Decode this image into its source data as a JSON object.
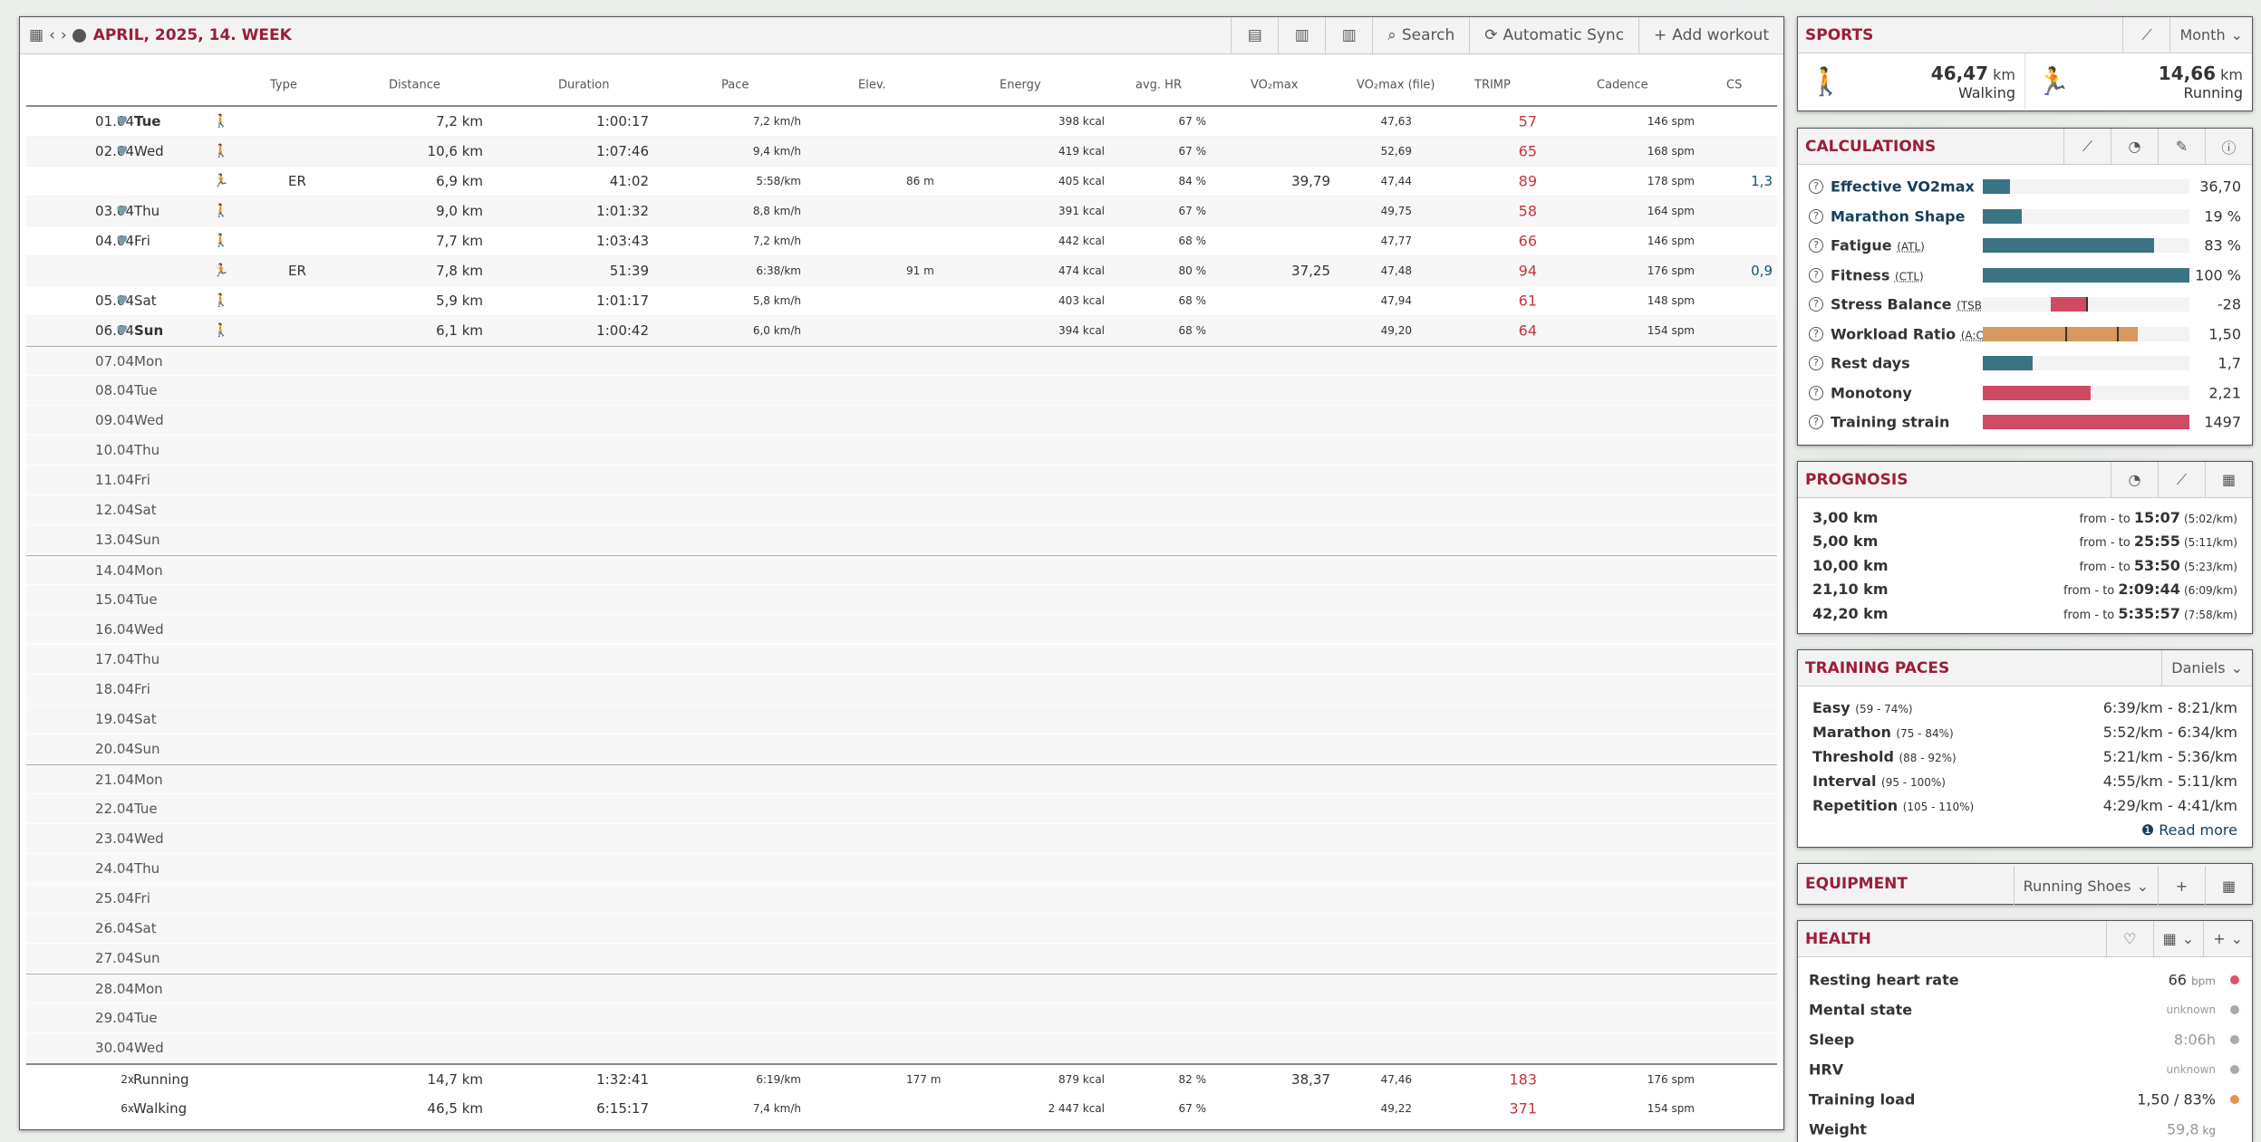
{
  "main": {
    "title": "APRIL, 2025, 14. WEEK",
    "toolbar": {
      "search": "Search",
      "sync": "Automatic Sync",
      "add": "Add workout"
    },
    "columns": {
      "type": "Type",
      "distance": "Distance",
      "duration": "Duration",
      "pace": "Pace",
      "elev": "Elev.",
      "energy": "Energy",
      "hr": "avg. HR",
      "vo2": "VO₂max",
      "vo2file": "VO₂max (file)",
      "trimp": "TRIMP",
      "cadence": "Cadence",
      "cs": "CS"
    },
    "rows": [
      {
        "date": "01.04",
        "day": "Tue",
        "bold": true,
        "icon": "walk",
        "type": "",
        "dist": "7,2 km",
        "dur": "1:00:17",
        "pace": "7,2 km/h",
        "elev": "",
        "energy": "398 kcal",
        "hr": "67 %",
        "vo2": "",
        "vo2f": "47,63",
        "trimp": "57",
        "cad": "146 spm",
        "cs": ""
      },
      {
        "date": "02.04",
        "day": "Wed",
        "bold": false,
        "icon": "walk",
        "type": "",
        "dist": "10,6 km",
        "dur": "1:07:46",
        "pace": "9,4 km/h",
        "elev": "",
        "energy": "419 kcal",
        "hr": "67 %",
        "vo2": "",
        "vo2f": "52,69",
        "trimp": "65",
        "cad": "168 spm",
        "cs": ""
      },
      {
        "date": "",
        "day": "",
        "bold": false,
        "icon": "run",
        "type": "ER",
        "dist": "6,9 km",
        "dur": "41:02",
        "pace": "5:58/km",
        "elev": "86 m",
        "energy": "405 kcal",
        "hr": "84 %",
        "vo2": "39,79",
        "vo2f": "47,44",
        "trimp": "89",
        "cad": "178 spm",
        "cs": "1,3"
      },
      {
        "date": "03.04",
        "day": "Thu",
        "bold": false,
        "icon": "walk",
        "type": "",
        "dist": "9,0 km",
        "dur": "1:01:32",
        "pace": "8,8 km/h",
        "elev": "",
        "energy": "391 kcal",
        "hr": "67 %",
        "vo2": "",
        "vo2f": "49,75",
        "trimp": "58",
        "cad": "164 spm",
        "cs": ""
      },
      {
        "date": "04.04",
        "day": "Fri",
        "bold": false,
        "icon": "walk",
        "type": "",
        "dist": "7,7 km",
        "dur": "1:03:43",
        "pace": "7,2 km/h",
        "elev": "",
        "energy": "442 kcal",
        "hr": "68 %",
        "vo2": "",
        "vo2f": "47,77",
        "trimp": "66",
        "cad": "146 spm",
        "cs": ""
      },
      {
        "date": "",
        "day": "",
        "bold": false,
        "icon": "run",
        "type": "ER",
        "dist": "7,8 km",
        "dur": "51:39",
        "pace": "6:38/km",
        "elev": "91 m",
        "energy": "474 kcal",
        "hr": "80 %",
        "vo2": "37,25",
        "vo2f": "47,48",
        "trimp": "94",
        "cad": "176 spm",
        "cs": "0,9"
      },
      {
        "date": "05.04",
        "day": "Sat",
        "bold": false,
        "icon": "walk",
        "type": "",
        "dist": "5,9 km",
        "dur": "1:01:17",
        "pace": "5,8 km/h",
        "elev": "",
        "energy": "403 kcal",
        "hr": "68 %",
        "vo2": "",
        "vo2f": "47,94",
        "trimp": "61",
        "cad": "148 spm",
        "cs": ""
      },
      {
        "date": "06.04",
        "day": "Sun",
        "bold": true,
        "icon": "walk",
        "type": "",
        "dist": "6,1 km",
        "dur": "1:00:42",
        "pace": "6,0 km/h",
        "elev": "",
        "energy": "394 kcal",
        "hr": "68 %",
        "vo2": "",
        "vo2f": "49,20",
        "trimp": "64",
        "cad": "154 spm",
        "cs": ""
      }
    ],
    "empty": [
      {
        "date": "07.04",
        "day": "Mon"
      },
      {
        "date": "08.04",
        "day": "Tue"
      },
      {
        "date": "09.04",
        "day": "Wed"
      },
      {
        "date": "10.04",
        "day": "Thu"
      },
      {
        "date": "11.04",
        "day": "Fri"
      },
      {
        "date": "12.04",
        "day": "Sat"
      },
      {
        "date": "13.04",
        "day": "Sun"
      },
      {
        "date": "14.04",
        "day": "Mon"
      },
      {
        "date": "15.04",
        "day": "Tue"
      },
      {
        "date": "16.04",
        "day": "Wed"
      },
      {
        "date": "17.04",
        "day": "Thu"
      },
      {
        "date": "18.04",
        "day": "Fri"
      },
      {
        "date": "19.04",
        "day": "Sat"
      },
      {
        "date": "20.04",
        "day": "Sun"
      },
      {
        "date": "21.04",
        "day": "Mon"
      },
      {
        "date": "22.04",
        "day": "Tue"
      },
      {
        "date": "23.04",
        "day": "Wed"
      },
      {
        "date": "24.04",
        "day": "Thu"
      },
      {
        "date": "25.04",
        "day": "Fri"
      },
      {
        "date": "26.04",
        "day": "Sat"
      },
      {
        "date": "27.04",
        "day": "Sun"
      },
      {
        "date": "28.04",
        "day": "Mon"
      },
      {
        "date": "29.04",
        "day": "Tue"
      },
      {
        "date": "30.04",
        "day": "Wed"
      }
    ],
    "summary": [
      {
        "count": "2x",
        "sport": "Running",
        "dist": "14,7 km",
        "dur": "1:32:41",
        "pace": "6:19/km",
        "elev": "177 m",
        "energy": "879 kcal",
        "hr": "82 %",
        "vo2": "38,37",
        "vo2f": "47,46",
        "trimp": "183",
        "cad": "176 spm"
      },
      {
        "count": "6x",
        "sport": "Walking",
        "dist": "46,5 km",
        "dur": "6:15:17",
        "pace": "7,4 km/h",
        "elev": "",
        "energy": "2 447 kcal",
        "hr": "67 %",
        "vo2": "",
        "vo2f": "49,22",
        "trimp": "371",
        "cad": "154 spm"
      }
    ]
  },
  "sports": {
    "title": "SPORTS",
    "period": "Month",
    "walking": {
      "value": "46,47",
      "unit": "km",
      "label": "Walking"
    },
    "running": {
      "value": "14,66",
      "unit": "km",
      "label": "Running"
    }
  },
  "calculations": {
    "title": "CALCULATIONS",
    "items": [
      {
        "label": "Effective VO2max",
        "abbr": "",
        "value": "36,70",
        "dark": true,
        "fill": 0.13,
        "color": "#3a7384"
      },
      {
        "label": "Marathon Shape",
        "abbr": "",
        "value": "19 %",
        "dark": true,
        "fill": 0.19,
        "color": "#3a7384"
      },
      {
        "label": "Fatigue",
        "abbr": "(ATL)",
        "value": "83 %",
        "dark": false,
        "fill": 0.83,
        "color": "#3a7384"
      },
      {
        "label": "Fitness",
        "abbr": "(CTL)",
        "value": "100 %",
        "dark": false,
        "fill": 1.0,
        "color": "#3a7384"
      },
      {
        "label": "Stress Balance",
        "abbr": "(TSB)",
        "value": "-28",
        "dark": false,
        "fill": 0.17,
        "start": 0.33,
        "color": "#cf4b64",
        "marker": 0.5
      },
      {
        "label": "Workload Ratio",
        "abbr": "(A:C)",
        "value": "1,50",
        "dark": false,
        "fill": 0.75,
        "color": "#d6985b",
        "marker": 0.4,
        "marker2": 0.65
      },
      {
        "label": "Rest days",
        "abbr": "",
        "value": "1,7",
        "dark": false,
        "fill": 0.24,
        "color": "#3a7384"
      },
      {
        "label": "Monotony",
        "abbr": "",
        "value": "2,21",
        "dark": false,
        "fill": 0.52,
        "color": "#cf4b64"
      },
      {
        "label": "Training strain",
        "abbr": "",
        "value": "1497",
        "dark": false,
        "fill": 1.0,
        "color": "#cf4b64"
      }
    ]
  },
  "prognosis": {
    "title": "PROGNOSIS",
    "from": "from",
    "dash": "-",
    "to": "to",
    "items": [
      {
        "dist": "3,00 km",
        "time": "15:07",
        "pace": "(5:02/km)"
      },
      {
        "dist": "5,00 km",
        "time": "25:55",
        "pace": "(5:11/km)"
      },
      {
        "dist": "10,00 km",
        "time": "53:50",
        "pace": "(5:23/km)"
      },
      {
        "dist": "21,10 km",
        "time": "2:09:44",
        "pace": "(6:09/km)"
      },
      {
        "dist": "42,20 km",
        "time": "5:35:57",
        "pace": "(7:58/km)"
      }
    ]
  },
  "paces": {
    "title": "TRAINING PACES",
    "method": "Daniels",
    "read_more": "Read more",
    "items": [
      {
        "name": "Easy",
        "range": "(59 - 74%)",
        "pace": "6:39/km - 8:21/km"
      },
      {
        "name": "Marathon",
        "range": "(75 - 84%)",
        "pace": "5:52/km - 6:34/km"
      },
      {
        "name": "Threshold",
        "range": "(88 - 92%)",
        "pace": "5:21/km - 5:36/km"
      },
      {
        "name": "Interval",
        "range": "(95 - 100%)",
        "pace": "4:55/km - 5:11/km"
      },
      {
        "name": "Repetition",
        "range": "(105 - 110%)",
        "pace": "4:29/km - 4:41/km"
      }
    ]
  },
  "equipment": {
    "title": "EQUIPMENT",
    "select": "Running Shoes"
  },
  "health": {
    "title": "HEALTH",
    "items": [
      {
        "name": "Resting heart rate",
        "value": "66",
        "unit": "bpm",
        "unknown": false,
        "dot": "#e05468"
      },
      {
        "name": "Mental state",
        "value": "unknown",
        "unit": "",
        "unknown": true,
        "dot": "#aaaaaa"
      },
      {
        "name": "Sleep",
        "value": "8:06h",
        "unit": "",
        "unknown": true,
        "dot": "#aaaaaa"
      },
      {
        "name": "HRV",
        "value": "unknown",
        "unit": "",
        "unknown": true,
        "dot": "#aaaaaa"
      },
      {
        "name": "Training load",
        "value": "1,50 / 83%",
        "unit": "",
        "unknown": false,
        "dot": "#e2944e"
      },
      {
        "name": "Weight",
        "value": "59,8",
        "unit": "kg",
        "unknown": true,
        "dot": ""
      }
    ]
  }
}
